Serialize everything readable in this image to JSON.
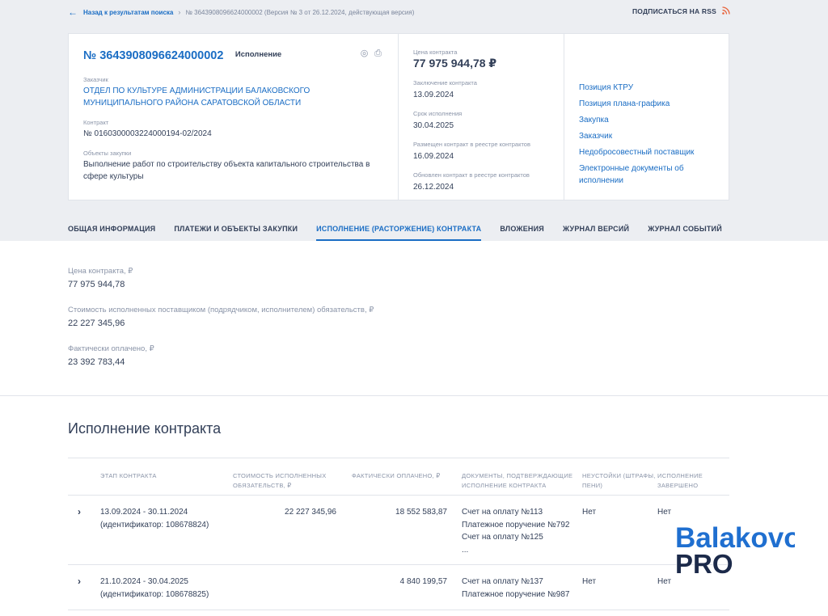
{
  "topbar": {
    "back_label": "Назад к результатам поиска",
    "breadcrumb_current": "№ 3643908096624000002 (Версия № 3 от 26.12.2024, действующая версия)",
    "rss_label": "ПОДПИСАТЬСЯ НА RSS"
  },
  "card": {
    "reg_number": "№ 3643908096624000002",
    "status": "Исполнение",
    "customer_label": "Заказчик",
    "customer_value": "ОТДЕЛ ПО КУЛЬТУРЕ АДМИНИСТРАЦИИ БАЛАКОВСКОГО МУНИЦИПАЛЬНОГО РАЙОНА САРАТОВСКОЙ ОБЛАСТИ",
    "contract_label": "Контракт",
    "contract_value": "№ 0160300003224000194-02/2024",
    "objects_label": "Объекты закупки",
    "objects_value": "Выполнение работ по строительству объекта капитального строительства в сфере культуры",
    "price_label": "Цена контракта",
    "price_value": "77 975 944,78 ₽",
    "conclusion_label": "Заключение контракта",
    "conclusion_value": "13.09.2024",
    "term_label": "Срок исполнения",
    "term_value": "30.04.2025",
    "placed_label": "Размещен контракт в реестре контрактов",
    "placed_value": "16.09.2024",
    "updated_label": "Обновлен контракт в реестре контрактов",
    "updated_value": "26.12.2024",
    "links": [
      "Позиция КТРУ",
      "Позиция плана-графика",
      "Закупка",
      "Заказчик",
      "Недобросовестный поставщик",
      "Электронные документы об исполнении"
    ]
  },
  "tabs": [
    "ОБЩАЯ ИНФОРМАЦИЯ",
    "ПЛАТЕЖИ И ОБЪЕКТЫ ЗАКУПКИ",
    "ИСПОЛНЕНИЕ (РАСТОРЖЕНИЕ) КОНТРАКТА",
    "ВЛОЖЕНИЯ",
    "ЖУРНАЛ ВЕРСИЙ",
    "ЖУРНАЛ СОБЫТИЙ"
  ],
  "active_tab_index": 2,
  "summary": {
    "price_label": "Цена контракта, ₽",
    "price_value": "77 975 944,78",
    "fulfilled_label": "Стоимость исполненных поставщиком (подрядчиком, исполнителем) обязательств, ₽",
    "fulfilled_value": "22 227 345,96",
    "paid_label": "Фактически оплачено, ₽",
    "paid_value": "23 392 783,44"
  },
  "section": {
    "title": "Исполнение контракта"
  },
  "table": {
    "headers": [
      "ЭТАП КОНТРАКТА",
      "СТОИМОСТЬ ИСПОЛНЕННЫХ ОБЯЗАТЕЛЬСТВ, ₽",
      "ФАКТИЧЕСКИ ОПЛАЧЕНО, ₽",
      "ДОКУМЕНТЫ, ПОДТВЕРЖДАЮЩИЕ ИСПОЛНЕНИЕ КОНТРАКТА",
      "НЕУСТОЙКИ (ШТРАФЫ, ПЕНИ)",
      "ИСПОЛНЕНИЕ ЗАВЕРШЕНО"
    ],
    "rows": [
      {
        "period": "13.09.2024 - 30.11.2024",
        "ident": "(идентификатор: 108678824)",
        "fulfilled": "22 227 345,96",
        "paid": "18 552 583,87",
        "docs": [
          "Счет на оплату №113",
          "Платежное поручение №792",
          "Счет на оплату №125",
          "..."
        ],
        "penalties": "Нет",
        "completed": "Нет"
      },
      {
        "period": "21.10.2024 - 30.04.2025",
        "ident": "(идентификатор: 108678825)",
        "fulfilled": "",
        "paid": "4 840 199,57",
        "docs": [
          "Счет на оплату №137",
          "Платежное поручение №987"
        ],
        "penalties": "Нет",
        "completed": "Нет"
      }
    ]
  },
  "watermark": {
    "line1": "Balakovo",
    "line2": "PRO",
    "color_blue": "#1f6fd0",
    "color_dark": "#1c2a4a"
  }
}
